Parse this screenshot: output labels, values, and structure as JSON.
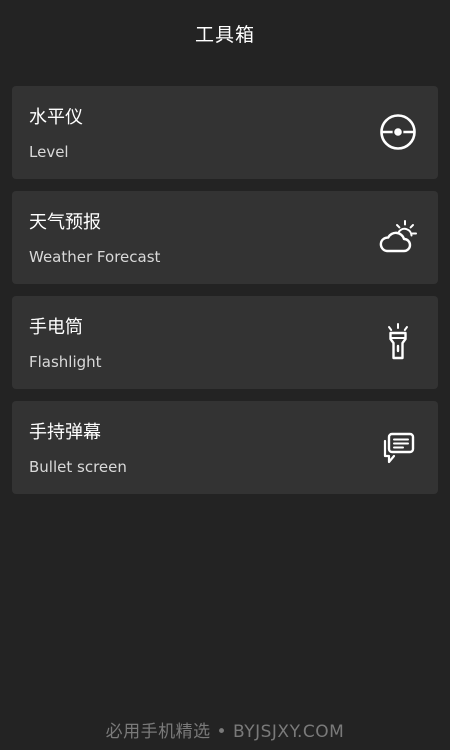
{
  "header": {
    "title": "工具箱"
  },
  "tools": [
    {
      "title": "水平仪",
      "subtitle": "Level",
      "icon": "level-icon"
    },
    {
      "title": "天气预报",
      "subtitle": "Weather Forecast",
      "icon": "weather-icon"
    },
    {
      "title": "手电筒",
      "subtitle": "Flashlight",
      "icon": "flashlight-icon"
    },
    {
      "title": "手持弹幕",
      "subtitle": "Bullet screen",
      "icon": "bullet-screen-icon"
    }
  ],
  "watermark": {
    "text": "必用手机精选 • BYJSJXY.COM"
  },
  "colors": {
    "background": "#232323",
    "card": "#333333",
    "text": "#ffffff",
    "subtext": "#d9d9d9",
    "watermark": "#7a7a7a"
  }
}
